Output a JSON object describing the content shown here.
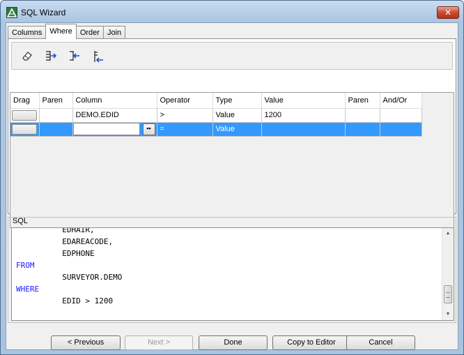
{
  "window": {
    "title": "SQL Wizard",
    "close_glyph": "✕"
  },
  "tabs": [
    {
      "label": "Columns"
    },
    {
      "label": "Where"
    },
    {
      "label": "Order"
    },
    {
      "label": "Join"
    }
  ],
  "active_tab": "Where",
  "toolbar": {
    "icons": [
      "eraser-icon",
      "add-condition-icon",
      "insert-condition-icon",
      "remove-condition-icon"
    ]
  },
  "grid": {
    "headers": [
      "Drag",
      "Paren",
      "Column",
      "Operator",
      "Type",
      "Value",
      "Paren",
      "And/Or"
    ],
    "rows": [
      {
        "paren_open": "",
        "column": "DEMO.EDID",
        "operator": ">",
        "type": "Value",
        "value": "1200",
        "paren_close": "",
        "and_or": ""
      },
      {
        "paren_open": "",
        "column": "",
        "operator": "=",
        "type": "Value",
        "value": "",
        "paren_close": "",
        "and_or": ""
      }
    ],
    "ellipsis_label": "••"
  },
  "sql": {
    "label": "SQL",
    "lines": [
      {
        "text": "          EDHAIR,",
        "keyword": false
      },
      {
        "text": "          EDAREACODE,",
        "keyword": false
      },
      {
        "text": "          EDPHONE",
        "keyword": false
      },
      {
        "text": "FROM",
        "keyword": true
      },
      {
        "text": "          SURVEYOR.DEMO",
        "keyword": false
      },
      {
        "text": "WHERE",
        "keyword": true
      },
      {
        "text": "          EDID > 1200",
        "keyword": false
      }
    ]
  },
  "buttons": {
    "previous": "< Previous",
    "next": "Next >",
    "done": "Done",
    "copy": "Copy to Editor",
    "cancel": "Cancel"
  },
  "colors": {
    "selection": "#3399ff",
    "keyword": "#1a1aff"
  }
}
